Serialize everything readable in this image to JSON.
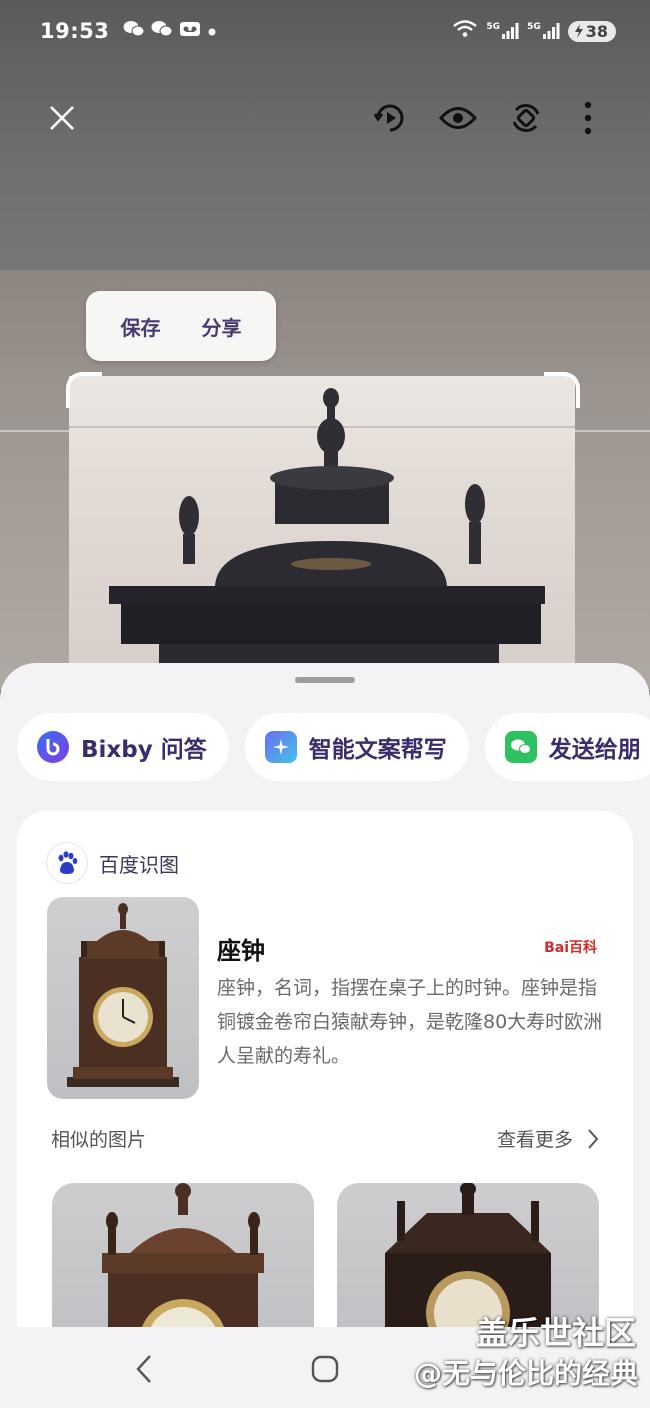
{
  "status_bar": {
    "time": "19:53",
    "network_1": "5G",
    "network_2": "5G",
    "battery": "38"
  },
  "toolbar": {
    "close_icon": "close-icon",
    "motion_icon": "motion-photo-icon",
    "view_icon": "eye-icon",
    "rotate_icon": "rotate-icon",
    "more_icon": "more-vertical-icon"
  },
  "popup_menu": {
    "save_label": "保存",
    "share_label": "分享"
  },
  "chips": [
    {
      "label": "Bixby 问答",
      "icon": "bixby-icon"
    },
    {
      "label": "智能文案帮写",
      "icon": "ai-write-icon"
    },
    {
      "label": "发送给朋",
      "icon": "wechat-icon"
    }
  ],
  "result_card": {
    "source": "百度识图",
    "title": "座钟",
    "baike_logo": "Bai百科",
    "description": "座钟，名词，指摆在桌子上的时钟。座钟是指铜镀金卷帘白猿献寿钟，是乾隆80大寿时欧洲人呈献的寿礼。",
    "similar_title": "相似的图片",
    "see_more": "查看更多"
  },
  "watermark": {
    "line1": "盖乐世社区",
    "line2": "@无与伦比的经典"
  },
  "colors": {
    "accent": "#3b2d6b",
    "sheet_bg": "#f3f2f4",
    "card_bg": "#ffffff"
  }
}
